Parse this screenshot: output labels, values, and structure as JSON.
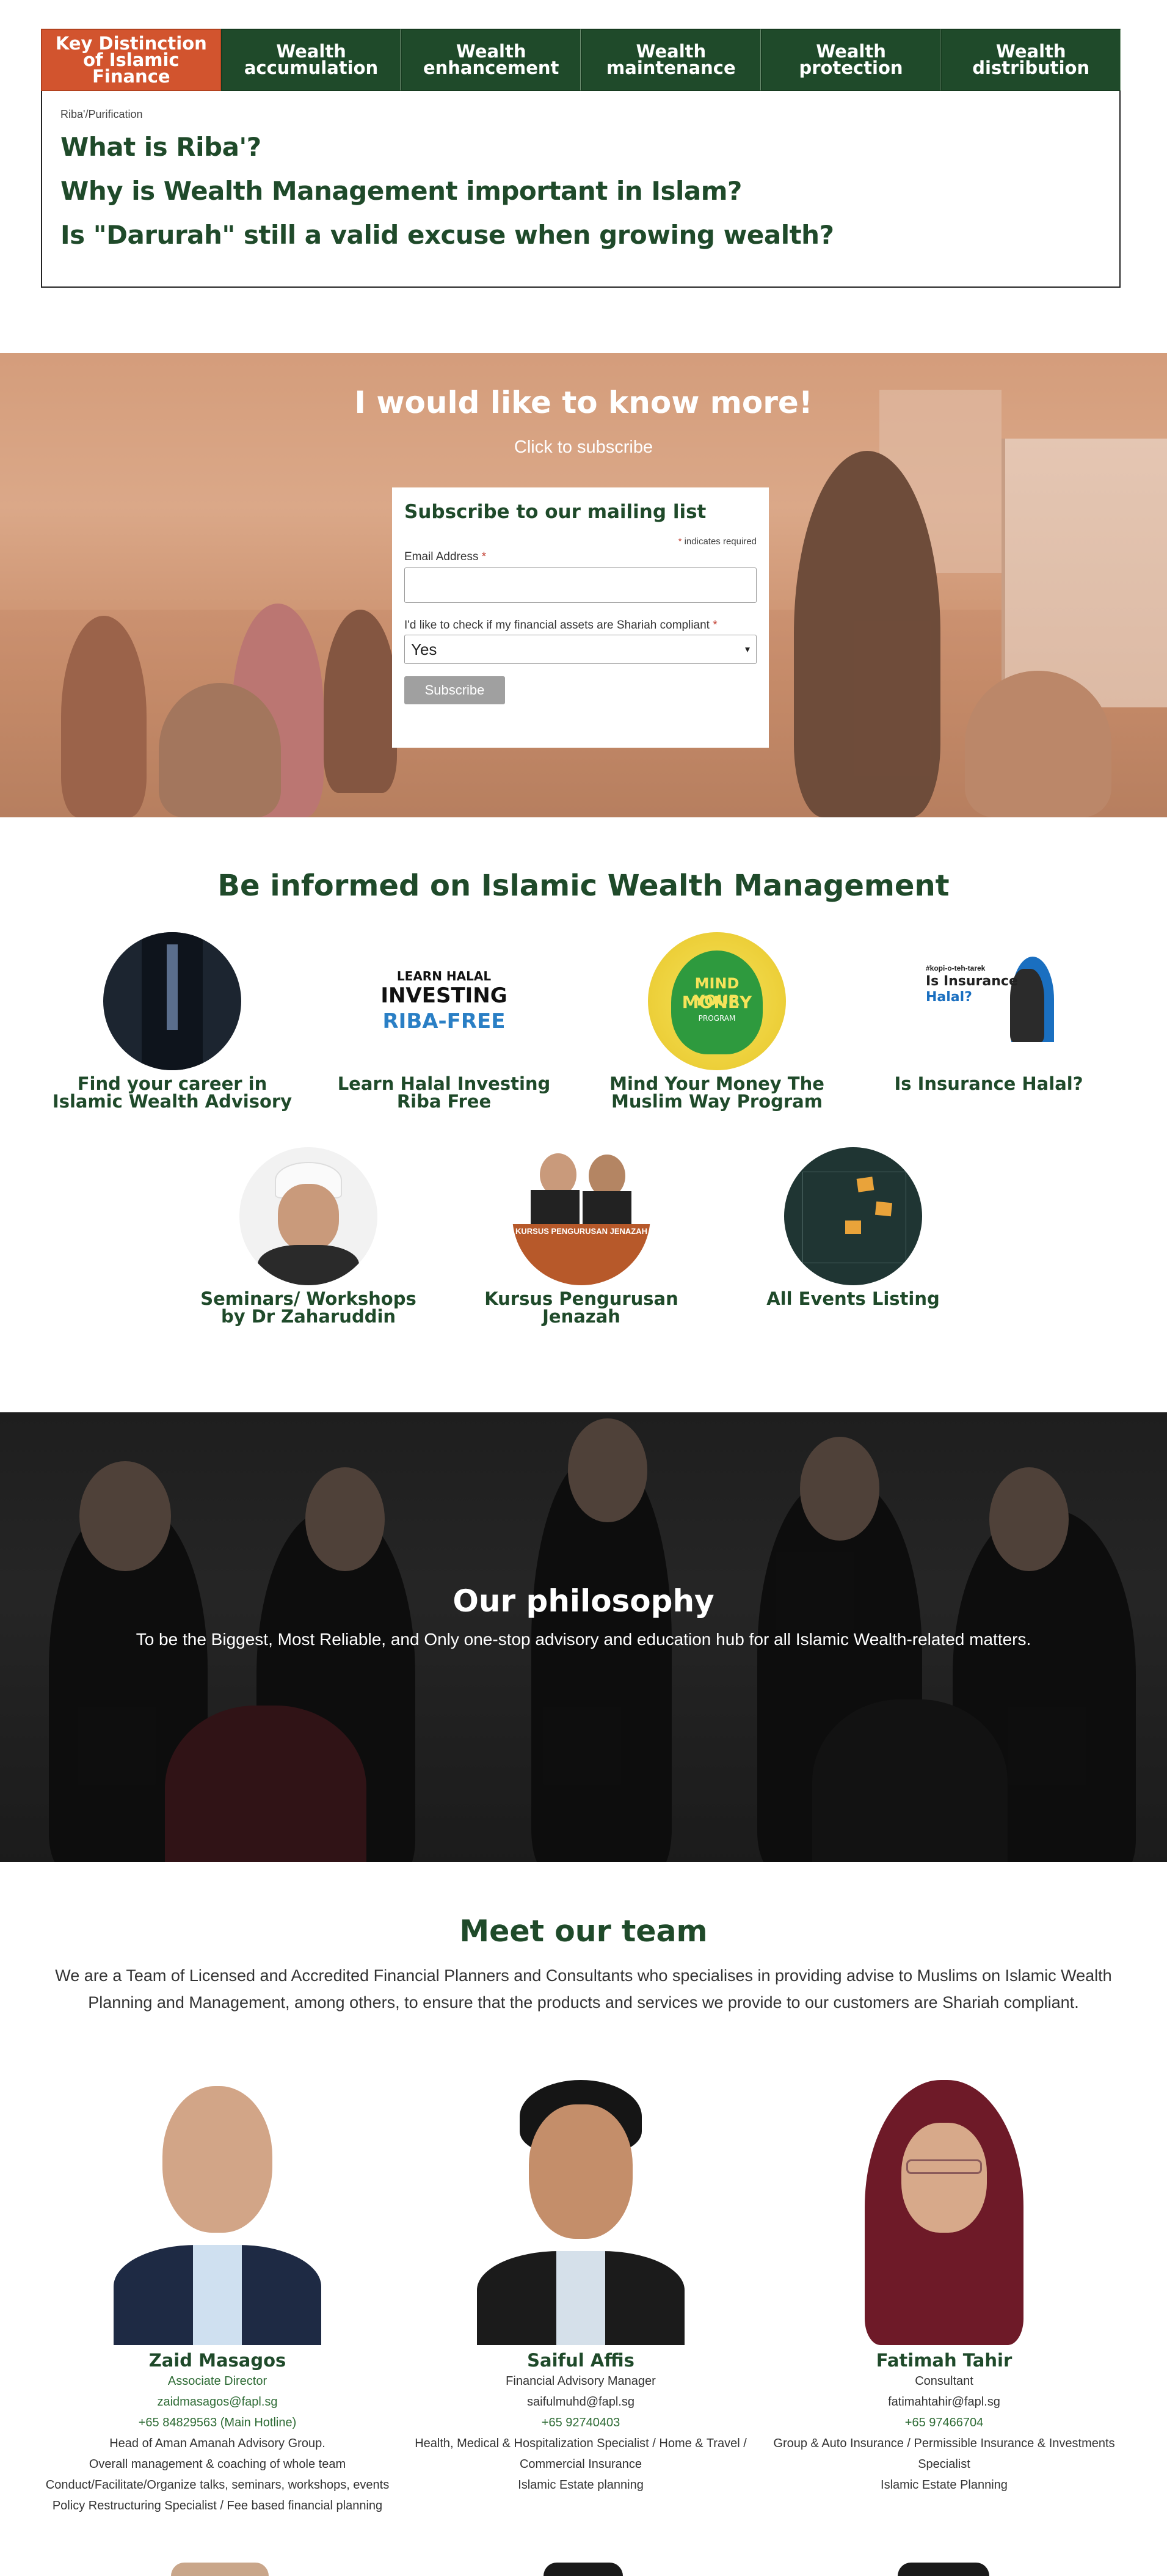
{
  "tabs": {
    "items": [
      {
        "label": "Key Distinction of Islamic Finance",
        "active": true
      },
      {
        "label": "Wealth accumulation",
        "active": false
      },
      {
        "label": "Wealth enhancement",
        "active": false
      },
      {
        "label": "Wealth maintenance",
        "active": false
      },
      {
        "label": "Wealth protection",
        "active": false
      },
      {
        "label": "Wealth distribution",
        "active": false
      }
    ],
    "panel": {
      "caption": "Riba'/Purification",
      "links": [
        "What is Riba'?",
        "Why is Wealth Management important in Islam?",
        "Is \"Darurah\" still a valid excuse when growing wealth?"
      ]
    }
  },
  "subscribe": {
    "title": "I would like to know more!",
    "subtitle": "Click to subscribe",
    "form": {
      "title": "Subscribe to our mailing list",
      "required_note": "indicates required",
      "email_label": "Email Address",
      "shariah_label": "I'd like to check if my financial assets are Shariah compliant",
      "shariah_value": "Yes",
      "submit_label": "Subscribe"
    }
  },
  "informed": {
    "title": "Be informed on Islamic Wealth Management",
    "cards": [
      {
        "label": "Find your career in Islamic Wealth Advisory"
      },
      {
        "label": "Learn Halal Investing Riba Free",
        "thumb_text": [
          "LEARN HALAL",
          "INVESTING",
          "RIBA-FREE"
        ]
      },
      {
        "label": "Mind Your Money The Muslim Way Program",
        "thumb_text": [
          "MIND YOUR",
          "MONEY",
          "PROGRAM"
        ]
      },
      {
        "label": "Is Insurance Halal?",
        "thumb_text": [
          "#kopi-o-teh-tarek",
          "Is Insurance",
          "Halal?"
        ]
      },
      {
        "label": "Seminars/ Workshops by Dr Zaharuddin"
      },
      {
        "label": "Kursus Pengurusan Jenazah",
        "thumb_text": [
          "KURSUS PENGURUSAN JENAZAH"
        ]
      },
      {
        "label": "All Events Listing"
      }
    ]
  },
  "philosophy": {
    "title": "Our philosophy",
    "text": "To be the Biggest, Most Reliable, and Only one-stop advisory and education hub for all Islamic Wealth-related matters."
  },
  "team": {
    "title": "Meet our team",
    "intro": "We are a Team of Licensed and Accredited Financial Planners and Consultants who specialises in providing advise to Muslims on Islamic Wealth Planning and Management, among others, to ensure that the products and services we provide to our customers are Shariah compliant.",
    "members": [
      {
        "name": "Zaid Masagos",
        "role": "Associate Director",
        "email": "zaidmasagos@fapl.sg",
        "phone": "+65 84829563 (Main Hotline)",
        "details": [
          "Head of Aman Amanah Advisory Group.",
          "Overall management & coaching of whole team",
          "Conduct/Facilitate/Organize talks, seminars, workshops, events",
          "Policy Restructuring Specialist / Fee based financial planning"
        ]
      },
      {
        "name": "Saiful Affis",
        "role": "Financial Advisory Manager",
        "email": "saifulmuhd@fapl.sg",
        "phone": "+65 92740403",
        "details": [
          "Health, Medical & Hospitalization Specialist / Home & Travel / Commercial Insurance",
          "Islamic Estate planning"
        ]
      },
      {
        "name": "Fatimah Tahir",
        "role": "Consultant",
        "email": "fatimahtahir@fapl.sg",
        "phone": "+65 97466704",
        "details": [
          "Group & Auto Insurance / Permissible Insurance & Investments Specialist",
          "Islamic Estate Planning"
        ]
      }
    ]
  },
  "colors": {
    "brand_green": "#1f4a2a",
    "accent_orange": "#d2542e",
    "required_red": "#c0392b"
  }
}
